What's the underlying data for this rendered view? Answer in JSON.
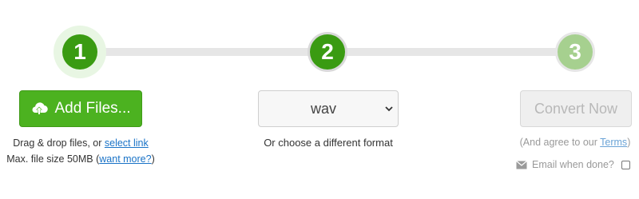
{
  "steps": [
    {
      "number": "1",
      "state": "active"
    },
    {
      "number": "2",
      "state": "done"
    },
    {
      "number": "3",
      "state": "pending"
    }
  ],
  "upload": {
    "button_label": "Add Files...",
    "button_icon": "cloud-upload-icon",
    "drag_text": "Drag & drop files, or ",
    "select_link": "select link",
    "size_text": "Max. file size 50MB (",
    "want_more_link": "want more?",
    "size_close": ")"
  },
  "format": {
    "selected": "wav",
    "caption": "Or choose a different format"
  },
  "convert": {
    "button_label": "Convert Now",
    "agree_prefix": "(And agree to our ",
    "terms_link": "Terms",
    "agree_suffix": ")",
    "email_label": "Email when done?",
    "email_checked": false
  },
  "colors": {
    "green": "#4cb220",
    "green_dark": "#3a9b12",
    "green_light": "#a6d08f",
    "link": "#1a73c7"
  }
}
